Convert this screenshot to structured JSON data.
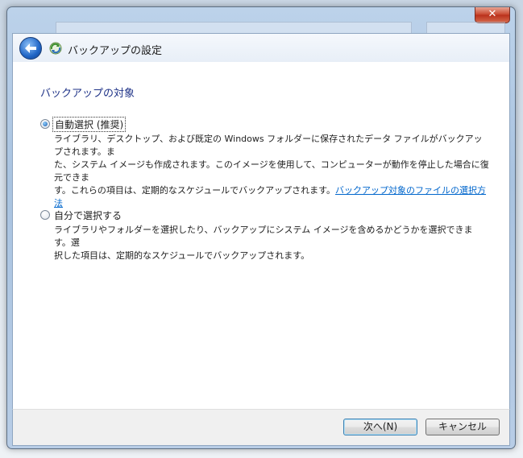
{
  "window": {
    "title": "バックアップの設定",
    "close_label": "✕"
  },
  "content": {
    "heading": "バックアップの対象",
    "options": [
      {
        "label": "自動選択 (推奨)",
        "selected": true,
        "desc_lines": [
          "ライブラリ、デスクトップ、および既定の Windows フォルダーに保存されたデータ ファイルがバックアップされます。ま",
          "た、システム イメージも作成されます。このイメージを使用して、コンピューターが動作を停止した場合に復元できま",
          "す。これらの項目は、定期的なスケジュールでバックアップされます。"
        ],
        "link": "バックアップ対象のファイルの選択方法"
      },
      {
        "label": "自分で選択する",
        "selected": false,
        "desc_lines": [
          "ライブラリやフォルダーを選択したり、バックアップにシステム イメージを含めるかどうかを選択できます。選",
          "択した項目は、定期的なスケジュールでバックアップされます。"
        ]
      }
    ]
  },
  "footer": {
    "next_label": "次へ(N)",
    "cancel_label": "キャンセル"
  },
  "icons": {
    "back": "back-arrow-icon",
    "app": "backup-icon"
  }
}
